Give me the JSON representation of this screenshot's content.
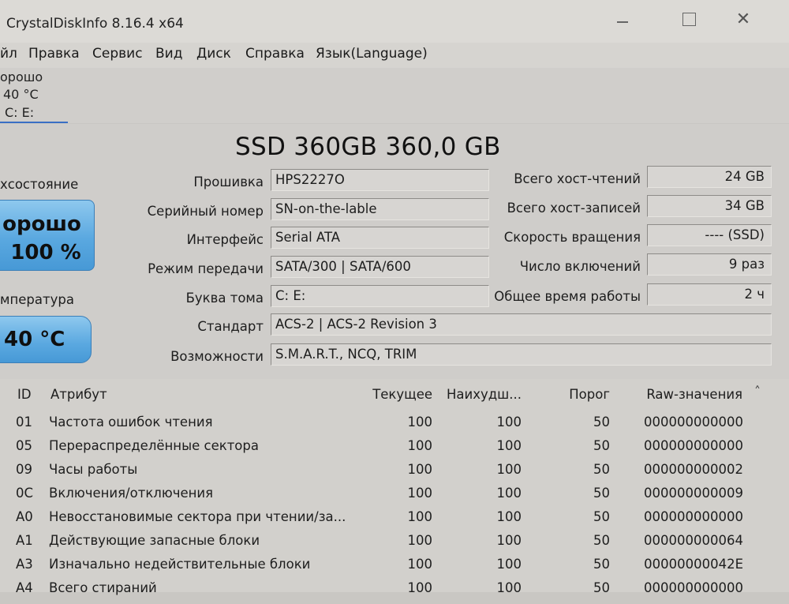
{
  "window": {
    "title": "CrystalDiskInfo 8.16.4 x64",
    "close_glyph": "✕"
  },
  "menu": [
    "йл",
    "Правка",
    "Сервис",
    "Вид",
    "Диск",
    "Справка",
    "Язык(Language)"
  ],
  "disk_tab": {
    "status": "орошо",
    "temp": "40 °C",
    "letters": "C: E:"
  },
  "model": "SSD 360GB 360,0 GB",
  "health": {
    "label": "хсостояние",
    "status": "орошо",
    "percent": "100 %"
  },
  "temperature": {
    "label": "мпература",
    "value": "40 °C"
  },
  "info_left": [
    {
      "label": "Прошивка",
      "value": "HPS2227O"
    },
    {
      "label": "Серийный номер",
      "value": "SN-on-the-lable"
    },
    {
      "label": "Интерфейс",
      "value": "Serial ATA"
    },
    {
      "label": "Режим передачи",
      "value": "SATA/300 | SATA/600"
    },
    {
      "label": "Буква тома",
      "value": "C: E:"
    }
  ],
  "info_wide": [
    {
      "label": "Стандарт",
      "value": "ACS-2 | ACS-2 Revision 3"
    },
    {
      "label": "Возможности",
      "value": "S.M.A.R.T., NCQ, TRIM"
    }
  ],
  "info_right": [
    {
      "label": "Всего хост-чтений",
      "value": "24 GB"
    },
    {
      "label": "Всего хост-записей",
      "value": "34 GB"
    },
    {
      "label": "Скорость вращения",
      "value": "---- (SSD)"
    },
    {
      "label": "Число включений",
      "value": "9 раз"
    },
    {
      "label": "Общее время работы",
      "value": "2 ч"
    }
  ],
  "table": {
    "headers": {
      "id": "ID",
      "attr": "Атрибут",
      "current": "Текущее",
      "worst": "Наихудш...",
      "threshold": "Порог",
      "raw": "Raw-значения"
    },
    "rows": [
      {
        "id": "01",
        "attr": "Частота ошибок чтения",
        "current": "100",
        "worst": "100",
        "threshold": "50",
        "raw": "000000000000"
      },
      {
        "id": "05",
        "attr": "Перераспределённые сектора",
        "current": "100",
        "worst": "100",
        "threshold": "50",
        "raw": "000000000000"
      },
      {
        "id": "09",
        "attr": "Часы работы",
        "current": "100",
        "worst": "100",
        "threshold": "50",
        "raw": "000000000002"
      },
      {
        "id": "0C",
        "attr": "Включения/отключения",
        "current": "100",
        "worst": "100",
        "threshold": "50",
        "raw": "000000000009"
      },
      {
        "id": "A0",
        "attr": "Невосстановимые сектора при чтении/за...",
        "current": "100",
        "worst": "100",
        "threshold": "50",
        "raw": "000000000000"
      },
      {
        "id": "A1",
        "attr": "Действующие запасные блоки",
        "current": "100",
        "worst": "100",
        "threshold": "50",
        "raw": "000000000064"
      },
      {
        "id": "A3",
        "attr": "Изначально недействительные блоки",
        "current": "100",
        "worst": "100",
        "threshold": "50",
        "raw": "00000000042E"
      },
      {
        "id": "A4",
        "attr": "Всего стираний",
        "current": "100",
        "worst": "100",
        "threshold": "50",
        "raw": "000000000000"
      }
    ]
  }
}
